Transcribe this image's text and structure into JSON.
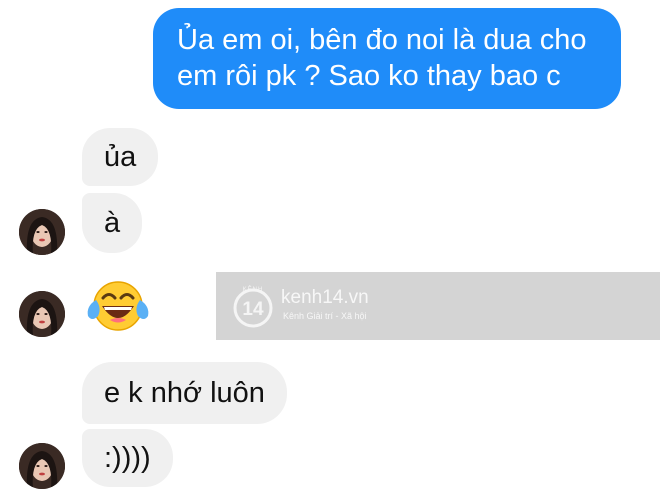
{
  "chat": {
    "sent": {
      "line1": "Ủa em oi, bên đo noi là dua cho",
      "line2": "em rôi pk ? Sao ko thay bao c"
    },
    "received": [
      {
        "text": "ủa"
      },
      {
        "text": "à"
      },
      {
        "emoji": "face-with-tears-of-joy"
      },
      {
        "text": "e k nhớ luôn"
      },
      {
        "text": ":))))"
      }
    ]
  },
  "watermark": {
    "logo_number": "14",
    "logo_top": "KÊNH",
    "site": "kenh14.vn",
    "tagline": "Kênh Giải trí - Xã hội"
  },
  "colors": {
    "sent_bubble": "#1f8cf9",
    "received_bubble": "#f0f0f0",
    "watermark_band": "#d4d4d4"
  }
}
